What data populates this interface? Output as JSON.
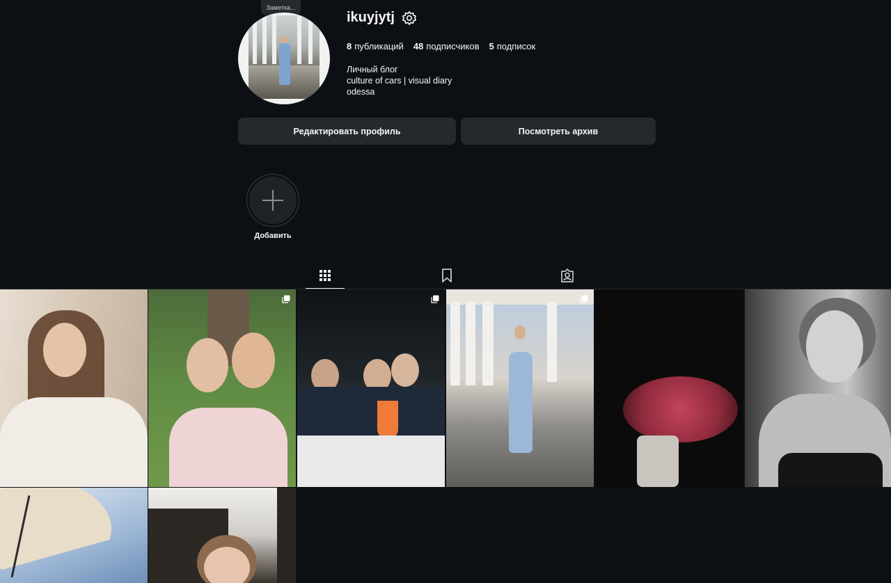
{
  "note": {
    "label": "Заметка..."
  },
  "profile": {
    "username": "ikuyjytj",
    "stats": {
      "posts_count": "8",
      "posts_label": "публикаций",
      "followers_count": "48",
      "followers_label": "подписчиков",
      "following_count": "5",
      "following_label": "подписок"
    },
    "bio": {
      "line1": "Личный блог",
      "line2": "culture of cars | visual diary",
      "line3": "odessa"
    }
  },
  "actions": {
    "edit_label": "Редактировать профиль",
    "archive_label": "Посмотреть архив"
  },
  "highlights": {
    "add_label": "Добавить"
  },
  "tabs": [
    {
      "icon": "grid-icon",
      "active": true
    },
    {
      "icon": "bookmark-icon",
      "active": false
    },
    {
      "icon": "tagged-icon",
      "active": false
    }
  ],
  "posts": [
    {
      "id": 1,
      "multi": false
    },
    {
      "id": 2,
      "multi": true
    },
    {
      "id": 3,
      "multi": true
    },
    {
      "id": 4,
      "multi": true
    },
    {
      "id": 5,
      "multi": false
    },
    {
      "id": 6,
      "multi": false
    },
    {
      "id": 7,
      "multi": false
    },
    {
      "id": 8,
      "multi": false
    }
  ],
  "colors": {
    "background": "#0c1014",
    "button": "#25292e",
    "text": "#f5f5f5"
  }
}
